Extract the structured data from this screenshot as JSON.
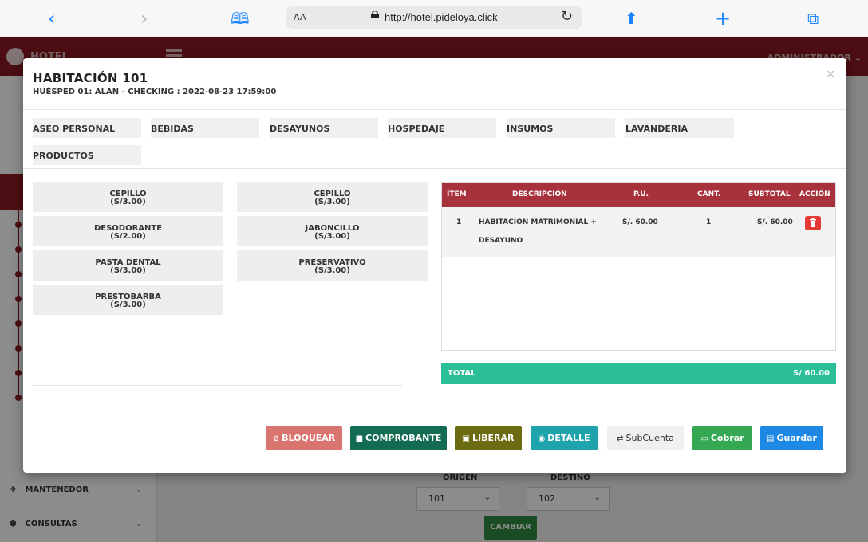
{
  "browser": {
    "aa": "AA",
    "url": "http://hotel.pideloya.click"
  },
  "app": {
    "logo_text": "HOTEL",
    "admin": "ADMINISTRADOR ⌄",
    "sidebar": [
      {
        "label": "MANTENEDOR"
      },
      {
        "label": "CONSULTAS"
      }
    ],
    "form": {
      "origin_label": "ORIGEN",
      "dest_label": "DESTINO",
      "origin_value": "101",
      "dest_value": "102",
      "change_button": "CAMBIAR"
    }
  },
  "modal": {
    "title": "HABITACIÓN  101",
    "subtitle": "HUÉSPED 01: ALAN - CHECKING : 2022-08-23 17:59:00",
    "close": "×",
    "categories": [
      "ASEO PERSONAL",
      "BEBIDAS",
      "DESAYUNOS",
      "HOSPEDAJE",
      "INSUMOS",
      "LAVANDERIA",
      "PRODUCTOS"
    ],
    "products": [
      {
        "name": "CEPILLO",
        "price": "(S/3.00)"
      },
      {
        "name": "CEPILLO",
        "price": "(S/3.00)"
      },
      {
        "name": "DESODORANTE",
        "price": "(S/2.00)"
      },
      {
        "name": "JABONCILLO",
        "price": "(S/3.00)"
      },
      {
        "name": "PASTA DENTAL",
        "price": "(S/3.00)"
      },
      {
        "name": "PRESERVATIVO",
        "price": "(S/3.00)"
      },
      {
        "name": "PRESTOBARBA",
        "price": "(S/3.00)"
      }
    ],
    "table": {
      "headers": [
        "ÍTEM",
        "DESCRIPCIÓN",
        "P.U.",
        "CANT.",
        "SUBTOTAL",
        "ACCIÓN"
      ],
      "rows": [
        {
          "item": "1",
          "desc1": "HABITACION MATRIMONIAL +",
          "desc2": "DESAYUNO",
          "pu": "S/. 60.00",
          "cant": "1",
          "subtotal": "S/. 60.00"
        }
      ],
      "total_label": "TOTAL",
      "total_value": "S/ 60.00"
    },
    "buttons": {
      "bloquear": "BLOQUEAR",
      "comprobante": "COMPROBANTE",
      "liberar": "LIBERAR",
      "detalle": "DETALLE",
      "subcuenta": "SubCuenta",
      "cobrar": "Cobrar",
      "guardar": "Guardar"
    }
  }
}
